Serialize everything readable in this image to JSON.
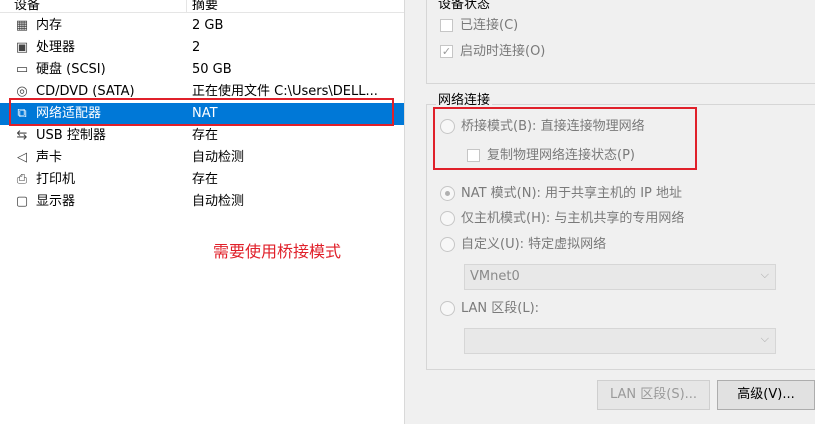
{
  "device_list": {
    "headers": {
      "device": "设备",
      "summary": "摘要"
    },
    "rows": [
      {
        "name": "内存",
        "value": "2 GB",
        "icon": "memory-icon"
      },
      {
        "name": "处理器",
        "value": "2",
        "icon": "processor-icon"
      },
      {
        "name": "硬盘 (SCSI)",
        "value": "50 GB",
        "icon": "hard-disk-icon"
      },
      {
        "name": "CD/DVD (SATA)",
        "value": "正在使用文件 C:\\Users\\DELL...",
        "icon": "cd-dvd-icon"
      },
      {
        "name": "网络适配器",
        "value": "NAT",
        "icon": "network-adapter-icon"
      },
      {
        "name": "USB 控制器",
        "value": "存在",
        "icon": "usb-icon"
      },
      {
        "name": "声卡",
        "value": "自动检测",
        "icon": "speaker-icon"
      },
      {
        "name": "打印机",
        "value": "存在",
        "icon": "printer-icon"
      },
      {
        "name": "显示器",
        "value": "自动检测",
        "icon": "monitor-icon"
      }
    ],
    "selected_index": 4
  },
  "annotation_note": "需要使用桥接模式",
  "device_status": {
    "title": "设备状态",
    "connected": {
      "label": "已连接(C)",
      "checked": false
    },
    "connect_at_power_on": {
      "label": "启动时连接(O)",
      "checked": true
    }
  },
  "network_connection": {
    "title": "网络连接",
    "bridged": {
      "label": "桥接模式(B): 直接连接物理网络",
      "selected": false
    },
    "replicate": {
      "label": "复制物理网络连接状态(P)",
      "checked": false
    },
    "nat": {
      "label": "NAT 模式(N): 用于共享主机的 IP 地址",
      "selected": true
    },
    "host_only": {
      "label": "仅主机模式(H): 与主机共享的专用网络",
      "selected": false
    },
    "custom": {
      "label": "自定义(U): 特定虚拟网络",
      "selected": false
    },
    "custom_value": "VMnet0",
    "lan_segment": {
      "label": "LAN 区段(L):",
      "selected": false
    },
    "lan_value": ""
  },
  "buttons": {
    "lan_segments": "LAN 区段(S)...",
    "advanced": "高级(V)..."
  },
  "colors": {
    "selection": "#0078d7",
    "annotation": "#e0202a"
  }
}
